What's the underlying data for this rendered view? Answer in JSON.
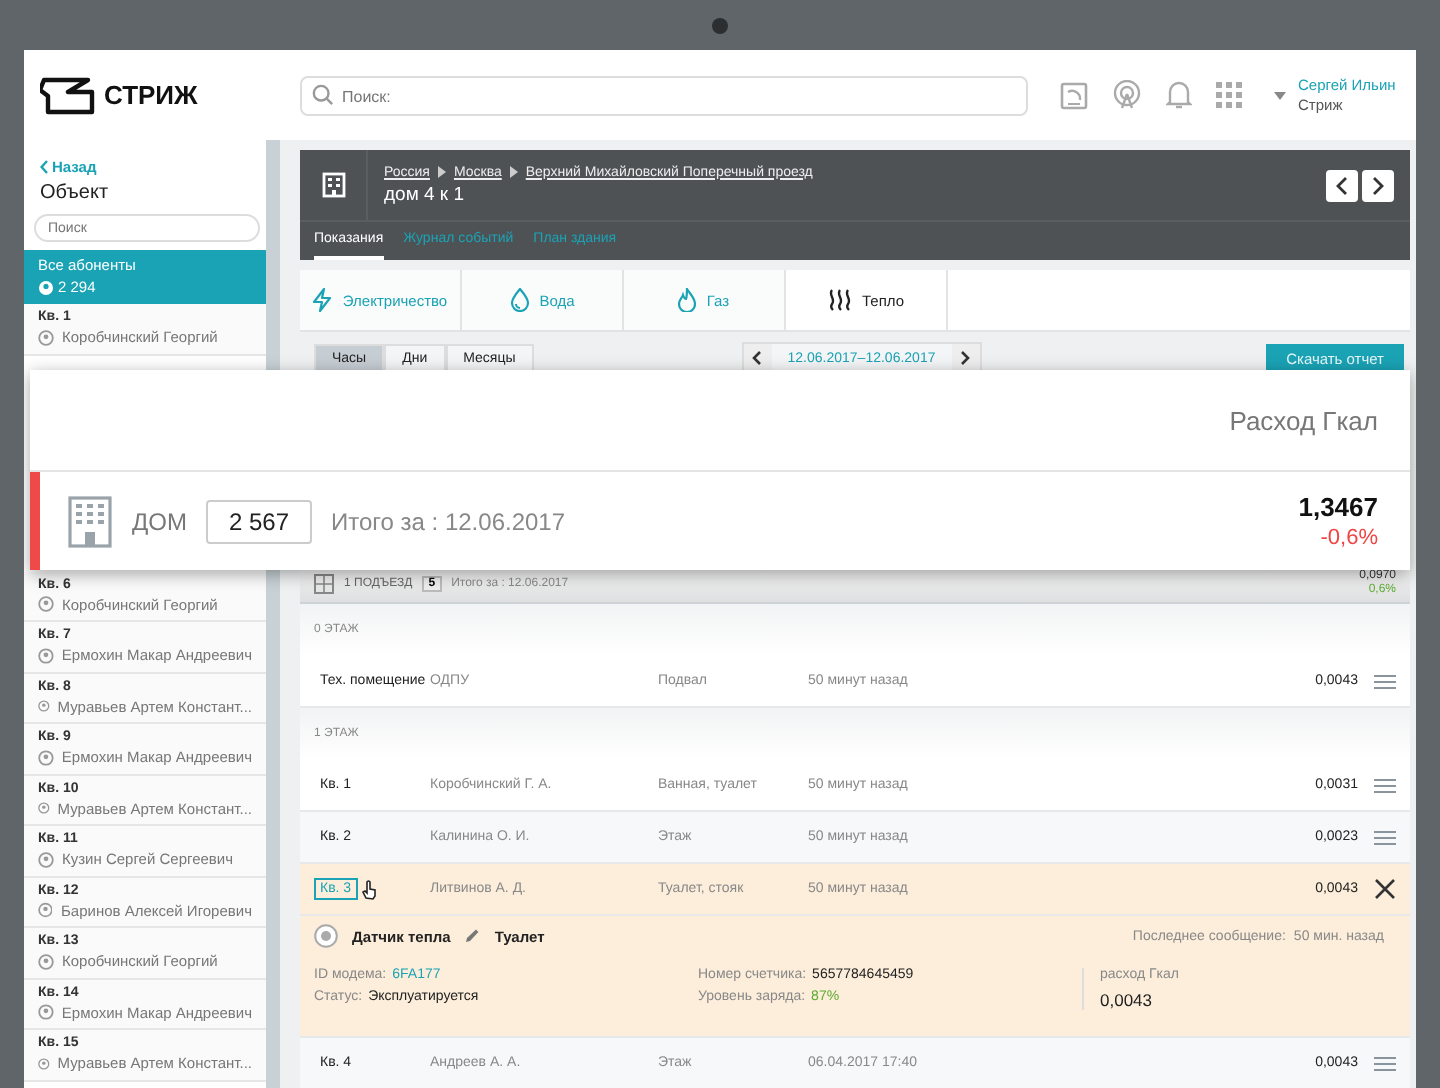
{
  "header": {
    "logo_text": "СТРИЖ",
    "search": {
      "placeholder": "Поиск:"
    },
    "user": {
      "name": "Сергей Ильин",
      "org": "Стриж"
    }
  },
  "sidebar": {
    "back": "Назад",
    "title": "Объект",
    "search": {
      "placeholder": "Поиск"
    },
    "all": {
      "label": "Все абоненты",
      "count": "2 294",
      "selected": true
    },
    "items_top": [
      {
        "label": "Кв. 1",
        "name": "Коробчинский Георгий"
      }
    ],
    "items": [
      {
        "label": "Кв. 6",
        "name": "Коробчинский Георгий"
      },
      {
        "label": "Кв. 7",
        "name": "Ермохин Макар Андреевич"
      },
      {
        "label": "Кв. 8",
        "name": "Муравьев Артем Констант..."
      },
      {
        "label": "Кв. 9",
        "name": "Ермохин Макар Андреевич"
      },
      {
        "label": "Кв. 10",
        "name": "Муравьев Артем Констант..."
      },
      {
        "label": "Кв. 11",
        "name": "Кузин Сергей Сергеевич"
      },
      {
        "label": "Кв. 12",
        "name": "Баринов Алексей Игоревич"
      },
      {
        "label": "Кв. 13",
        "name": "Коробчинский Георгий"
      },
      {
        "label": "Кв. 14",
        "name": "Ермохин Макар Андреевич"
      },
      {
        "label": "Кв. 15",
        "name": "Муравьев Артем Констант..."
      }
    ]
  },
  "building": {
    "breadcrumbs": [
      "Россия",
      "Москва",
      "Верхний Михайловский Поперечный проезд"
    ],
    "title": "дом 4 к 1",
    "tabs": [
      {
        "label": "Показания",
        "selected": true
      },
      {
        "label": "Журнал событий",
        "selected": false
      },
      {
        "label": "План здания",
        "selected": false
      }
    ]
  },
  "utilities": [
    {
      "label": "Электричество",
      "kind": "electric",
      "selected": false
    },
    {
      "label": "Вода",
      "kind": "water",
      "selected": false
    },
    {
      "label": "Газ",
      "kind": "gas",
      "selected": false
    },
    {
      "label": "Тепло",
      "kind": "heat",
      "selected": true
    }
  ],
  "periods": [
    {
      "label": "Часы",
      "selected": true
    },
    {
      "label": "Дни",
      "selected": false
    },
    {
      "label": "Месяцы",
      "selected": false
    }
  ],
  "date_range": "12.06.2017–12.06.2017",
  "download": "Скачать отчет",
  "overlay": {
    "column": "Расход Гкал",
    "label": "ДОМ",
    "count": "2 567",
    "total": "Итого за : 12.06.2017",
    "value": "1,3467",
    "change": "-0,6%",
    "negative": true
  },
  "entrance": {
    "label": "1 ПОДЪЕЗД",
    "count": "5",
    "total": "Итого за : 12.06.2017",
    "value": "0,0970",
    "change": "0,6%",
    "negative": false
  },
  "floors": [
    {
      "label": "0 ЭТАЖ",
      "rows": [
        {
          "apt": "Тех. помещение",
          "owner": "ОДПУ",
          "place": "Подвал",
          "time": "50 минут назад",
          "value": "0,0043",
          "expanded": false
        }
      ]
    },
    {
      "label": "1 ЭТАЖ",
      "rows": [
        {
          "apt": "Кв. 1",
          "owner": "Коробчинский Г. А.",
          "place": "Ванная, туалет",
          "time": "50 минут назад",
          "value": "0,0031",
          "expanded": false
        },
        {
          "apt": "Кв. 2",
          "owner": "Калинина О. И.",
          "place": "Этаж",
          "time": "50 минут назад",
          "value": "0,0023",
          "expanded": false
        },
        {
          "apt": "Кв. 3",
          "owner": "Литвинов А. Д.",
          "place": "Туалет, стояк",
          "time": "50 минут назад",
          "value": "0,0043",
          "expanded": true
        },
        {
          "apt": "Кв. 4",
          "owner": "Андреев А. А.",
          "place": "Этаж",
          "time": "06.04.2017 17:40",
          "value": "0,0043",
          "expanded": false
        }
      ]
    }
  ],
  "detail": {
    "sensor": "Датчик тепла",
    "location": "Туалет",
    "last_message_label": "Последнее сообщение:",
    "last_message": "50 мин. назад",
    "modem_label": "ID модема:",
    "modem": "6FA177",
    "status_label": "Статус:",
    "status": "Эксплуатируется",
    "meter_label": "Номер счетчика:",
    "meter": "5657784645459",
    "charge_label": "Уровень заряда:",
    "charge": "87%",
    "usage_label": "расход Гкал",
    "usage": "0,0043"
  }
}
